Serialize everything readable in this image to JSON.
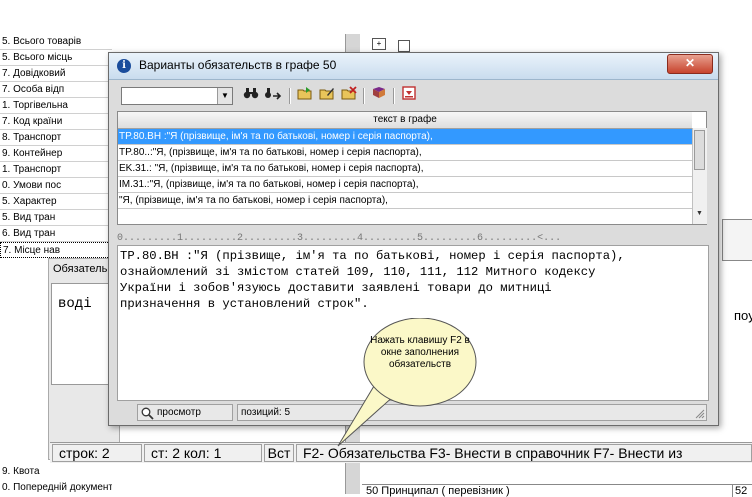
{
  "background": {
    "left_list": [
      "5. Всього товарів",
      "5. Всього місць",
      "7. Довідковий",
      "7. Особа відп",
      "1. Торгівельна",
      "7. Код країни",
      "8. Транспорт",
      "9. Контейнер",
      "1. Транспорт",
      "0. Умови пос",
      "5. Характер",
      "5. Вид тран",
      "6. Вид тран",
      "7. Місце нав"
    ],
    "left_list_bottom": [
      "9. Квота",
      "0. Попередній документ"
    ],
    "obl_label": "Обязатель",
    "obl_text": "воді",
    "right_fragment": "пoу",
    "bottom_right_field": "50  Принципал  ( перевізник )",
    "bottom_right_num": "52",
    "status": {
      "rows_label": "строк: 2",
      "col_label": "ст:  2 кол:  1",
      "mode": "Вст",
      "hints": "F2- Обязательства  F3- Внести в справочник  F7- Внести из"
    }
  },
  "dialog": {
    "title": "Варианты обязательств в графе 50",
    "close_symbol": "✕",
    "icon_letter": "i",
    "filter_value": "",
    "grid_header": "текст в графе",
    "rows": [
      "TP.80.BH :\"Я (прізвище, ім'я та по батькові, номер і серія паспорта),",
      "TP.80..:\"Я, (прізвище, ім'я та по батькові, номер і серія паспорта),",
      "EK.31.: \"Я, (прізвище, ім'я та по батькові, номер і серія паспорта),",
      "IM.31.:\"Я, (прізвище, ім'я та по батькові, номер і серія паспорта),",
      "\"Я, (прізвище, ім'я та по батькові, номер і серія паспорта),"
    ],
    "ruler": "0.........1.........2.........3.........4.........5.........6.........<...",
    "editor_lines": [
      "ТР.80.ВН :\"Я (прізвище, ім'я та по батькові, номер і серія паспорта),",
      "ознайомлений зі змістом статей 109, 110, 111, 112 Митного кодексу",
      "України і зобов'язуюсь доставити заявлені товари до митниці",
      "призначення в установлений строк\"."
    ],
    "callout": "Нажать клавишу F2 в окне заполнения обязательств",
    "view_label": "просмотр",
    "positions_label": "позиций: 5"
  }
}
